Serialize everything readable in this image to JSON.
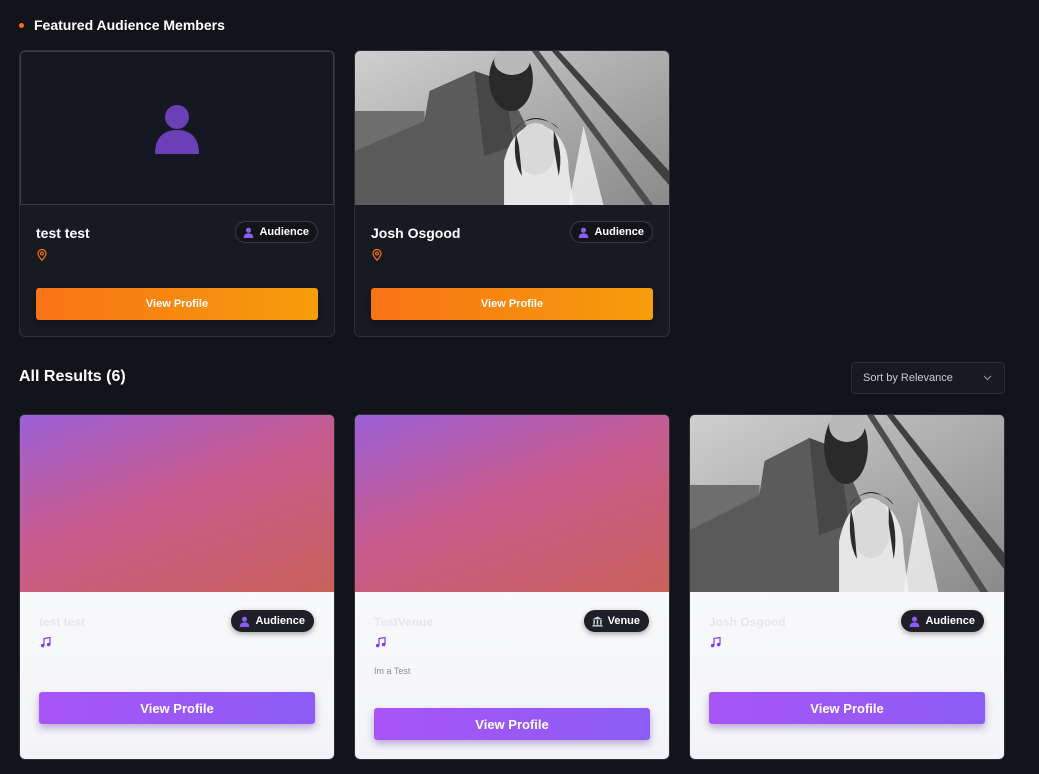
{
  "featured": {
    "title": "Featured Audience Members",
    "cards": [
      {
        "name": "test test",
        "badge": "Audience",
        "badge_icon": "user-icon",
        "button": "View Profile",
        "has_photo": false
      },
      {
        "name": "Josh Osgood",
        "badge": "Audience",
        "badge_icon": "user-icon",
        "button": "View Profile",
        "has_photo": true
      }
    ]
  },
  "results": {
    "title": "All Results (6)",
    "sort": {
      "selected": "Sort by Relevance"
    },
    "cards": [
      {
        "name": "test test",
        "badge": "Audience",
        "badge_icon": "user-icon",
        "description": "",
        "button": "View Profile"
      },
      {
        "name": "TestVenue",
        "badge": "Venue",
        "badge_icon": "building-icon",
        "description": "Im a Test",
        "button": "View Profile"
      },
      {
        "name": "Josh Osgood",
        "badge": "Audience",
        "badge_icon": "user-icon",
        "description": "",
        "button": "View Profile"
      }
    ]
  },
  "colors": {
    "background": "#13141a",
    "accent_orange": "#f97316",
    "accent_purple": "#a855f7",
    "avatar_purple": "#6b3fb5"
  }
}
